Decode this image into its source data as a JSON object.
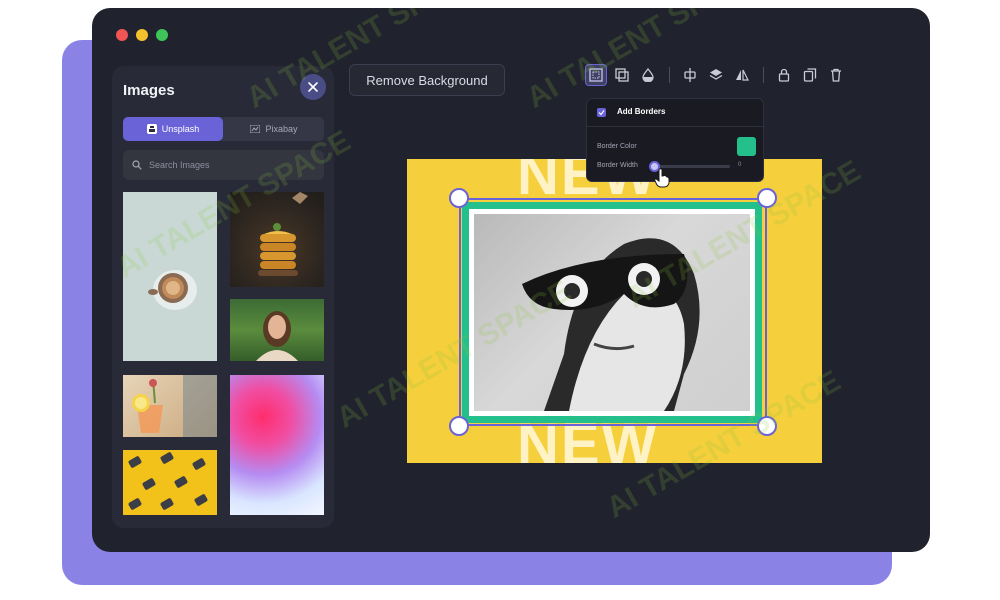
{
  "window": {
    "dots": [
      "close",
      "minimize",
      "maximize"
    ]
  },
  "images_panel": {
    "title": "Images",
    "close_icon": "close-icon",
    "tabs": [
      {
        "label": "Unsplash",
        "icon": "unsplash-icon",
        "active": true
      },
      {
        "label": "Pixabay",
        "icon": "pixabay-icon",
        "active": false
      }
    ],
    "search": {
      "placeholder": "Search Images",
      "value": ""
    },
    "thumbnails": [
      "coffee-cup-photo",
      "pancake-stack-photo",
      "smiling-woman-photo",
      "cocktail-photo",
      "gradient-abstract-photo",
      "yellow-pattern-photo"
    ]
  },
  "toolbar": {
    "remove_background_label": "Remove Background",
    "tools": [
      "border-icon",
      "layer-copy-icon",
      "opacity-icon",
      "align-icon",
      "layers-icon",
      "flip-icon",
      "lock-icon",
      "duplicate-icon",
      "delete-icon"
    ]
  },
  "border_popover": {
    "title": "Add Borders",
    "checked": true,
    "color_label": "Border Color",
    "color": "#23c08c",
    "width_label": "Border Width",
    "width_fraction": 0.05,
    "width_value": "0"
  },
  "canvas": {
    "top_text": "NEW",
    "bottom_text": "NEW",
    "background": "#f5cf3c",
    "frame_color": "#23c08c"
  },
  "watermark": "AI TALENT SPACE",
  "colors": {
    "accent": "#6a63d8",
    "window_bg": "#20222d",
    "backdrop": "#8b82e6"
  }
}
